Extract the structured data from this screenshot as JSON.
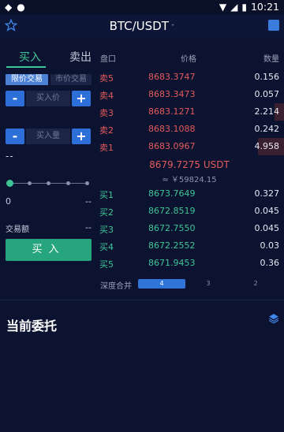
{
  "status": {
    "time": "10:21"
  },
  "header": {
    "title": "BTC/USDT",
    "caret": "ˇ"
  },
  "tabs": {
    "buy": "买入",
    "sell": "卖出"
  },
  "order_type": {
    "limit": "限价交易",
    "market": "市价交易"
  },
  "price_input": {
    "placeholder": "买入价",
    "minus": "-",
    "plus": "+"
  },
  "amount_input": {
    "placeholder": "买入量",
    "minus": "-",
    "plus": "+"
  },
  "estimate": "--",
  "slider": {
    "value": 0
  },
  "available": {
    "left": "0",
    "right": "--"
  },
  "volume": {
    "label": "交易额",
    "value": "--"
  },
  "submit": "买入",
  "orderbook": {
    "headers": {
      "book": "盘口",
      "price": "价格",
      "qty": "数量"
    },
    "asks": [
      {
        "label": "卖5",
        "price": "8683.3747",
        "qty": "0.156"
      },
      {
        "label": "卖4",
        "price": "8683.3473",
        "qty": "0.057"
      },
      {
        "label": "卖3",
        "price": "8683.1271",
        "qty": "2.214"
      },
      {
        "label": "卖2",
        "price": "8683.1088",
        "qty": "0.242"
      },
      {
        "label": "卖1",
        "price": "8683.0967",
        "qty": "4.958"
      }
    ],
    "last_price": "8679.7275 USDT",
    "last_cny": "≈ ￥59824.15",
    "bids": [
      {
        "label": "买1",
        "price": "8673.7649",
        "qty": "0.327"
      },
      {
        "label": "买2",
        "price": "8672.8519",
        "qty": "0.045"
      },
      {
        "label": "买3",
        "price": "8672.7550",
        "qty": "0.045"
      },
      {
        "label": "买4",
        "price": "8672.2552",
        "qty": "0.03"
      },
      {
        "label": "买5",
        "price": "8671.9453",
        "qty": "0.36"
      }
    ]
  },
  "depth_merge": {
    "label": "深度合并",
    "options": [
      "4",
      "3",
      "2"
    ],
    "selected": "4"
  },
  "orders": {
    "title": "当前委托"
  },
  "colors": {
    "buy": "#3ec596",
    "sell": "#e45b5b",
    "accent": "#2f74d8",
    "background": "#0c1330"
  }
}
